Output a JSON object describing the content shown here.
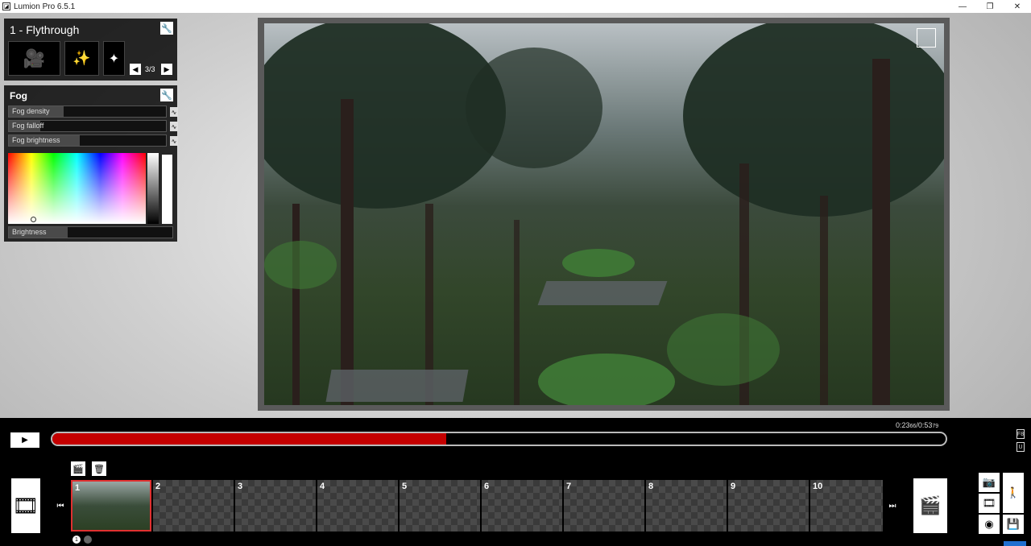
{
  "window": {
    "title": "Lumion Pro 6.5.1",
    "icon": "lumion-icon",
    "controls": [
      "—",
      "❐",
      "✕"
    ]
  },
  "mode_panel": {
    "title": "1 - Flythrough",
    "buttons": [
      {
        "name": "movie-camera-icon",
        "glyph": "🎥"
      },
      {
        "name": "effects-icon",
        "glyph": "✨"
      },
      {
        "name": "more-effects-icon",
        "glyph": "✦"
      }
    ],
    "page": "3/3",
    "prev": "◀",
    "next": "▶"
  },
  "fog_panel": {
    "title": "Fog",
    "sliders": [
      {
        "label": "Fog density",
        "value": 0.35
      },
      {
        "label": "Fog falloff",
        "value": 0.2
      },
      {
        "label": "Fog brightness",
        "value": 0.45
      }
    ],
    "curve_glyph": "∿",
    "brightness": {
      "label": "Brightness",
      "value": 0.36
    }
  },
  "timeline": {
    "play": "▶",
    "time": "0:23",
    "time_sub": "66",
    "duration": "/0:53",
    "duration_sub": "79",
    "progress": 0.441,
    "side_keys": [
      "F8",
      "U"
    ]
  },
  "clip_tools": {
    "new": "🎬",
    "delete": "🗑"
  },
  "filmstrip": {
    "left_arrow": "⏮",
    "right_arrow": "⏭",
    "slots": [
      "1",
      "2",
      "3",
      "4",
      "5",
      "6",
      "7",
      "8",
      "9",
      "10"
    ],
    "active_index": 0,
    "page_dots": [
      "1",
      ""
    ]
  },
  "right_modes": {
    "camera": "📷",
    "film": "🎞",
    "globe": "◉",
    "walker": "🚶",
    "save": "💾"
  }
}
